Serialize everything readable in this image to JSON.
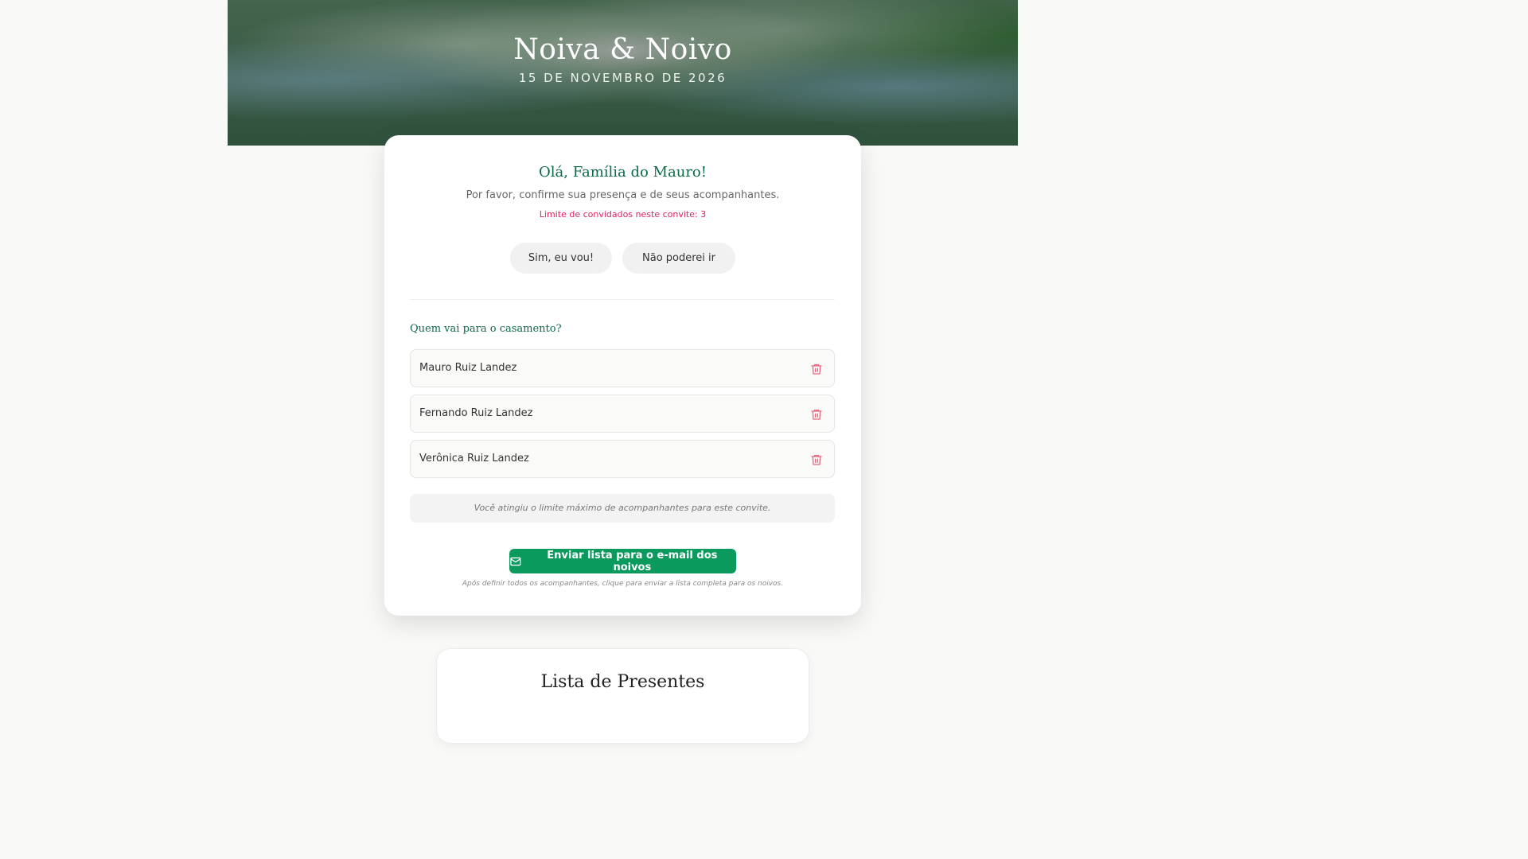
{
  "hero": {
    "title": "Noiva & Noivo",
    "date": "15 DE NOVEMBRO DE 2026"
  },
  "rsvp": {
    "greeting": "Olá, Família do Mauro!",
    "subtitle": "Por favor, confirme sua presença e de seus acompanhantes.",
    "limit_text": "Limite de convidados neste convite: 3",
    "yes_label": "Sim, eu vou!",
    "no_label": "Não poderei ir",
    "section_title": "Quem vai para o casamento?",
    "guests": [
      {
        "name": "Mauro Ruiz Landez"
      },
      {
        "name": "Fernando Ruiz Landez"
      },
      {
        "name": "Verônica Ruiz Landez"
      }
    ],
    "limit_reached_note": "Você atingiu o limite máximo de acompanhantes para este convite.",
    "send_label": "Enviar lista para o e-mail dos noivos",
    "send_hint": "Após definir todos os acompanhantes, clique para enviar a lista completa para os noivos."
  },
  "gifts": {
    "title": "Lista de Presentes"
  },
  "colors": {
    "accent_green": "#0b6b45",
    "button_green": "#0b9a5e",
    "limit_red": "#e0245e",
    "trash_red": "#e8697f"
  },
  "icons": {
    "trash": "trash-icon",
    "mail": "mail-icon"
  }
}
